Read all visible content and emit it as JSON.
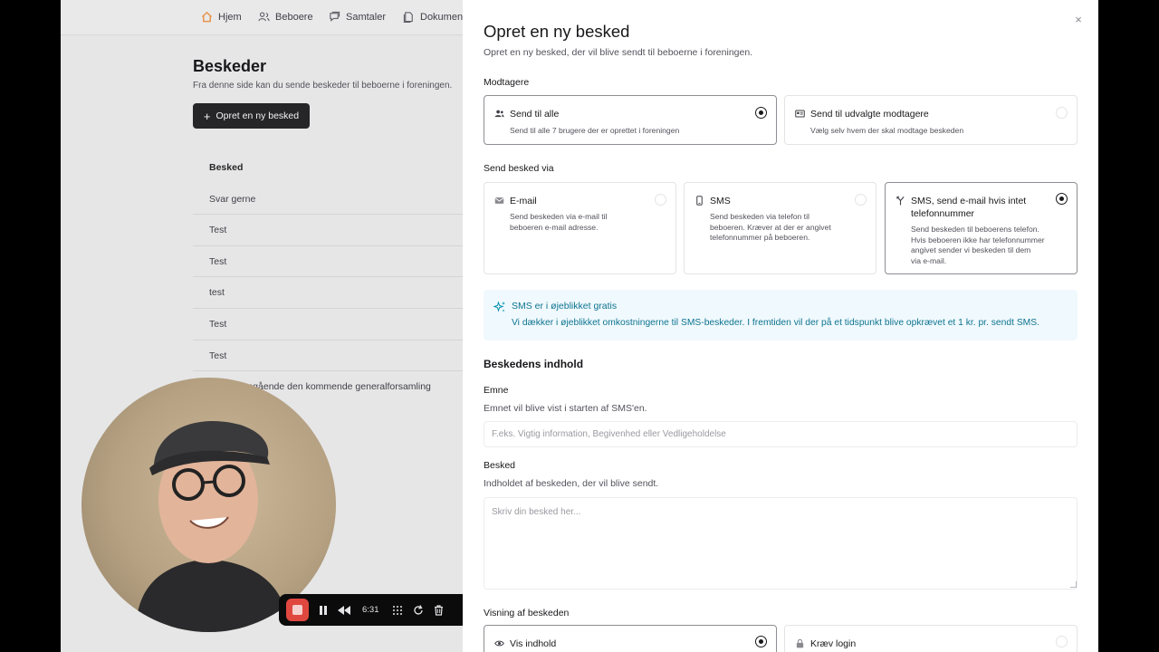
{
  "nav": {
    "items": [
      {
        "label": "Hjem",
        "icon": "home-icon"
      },
      {
        "label": "Beboere",
        "icon": "users-icon"
      },
      {
        "label": "Samtaler",
        "icon": "chat-icon"
      },
      {
        "label": "Dokumen",
        "icon": "document-icon"
      }
    ]
  },
  "page": {
    "title": "Beskeder",
    "subtitle": "Fra denne side kan du sende beskeder til beboerne i foreningen.",
    "new_button": "Opret en ny besked"
  },
  "table": {
    "header": "Besked",
    "rows": [
      "Svar gerne",
      "Test",
      "Test",
      "test",
      "Test",
      "Test",
      "…angående den kommende generalforsamling"
    ]
  },
  "recorder": {
    "time": "6:31"
  },
  "modal": {
    "title": "Opret en ny besked",
    "subtitle": "Opret en ny besked, der vil blive sendt til beboerne i foreningen.",
    "recipients": {
      "label": "Modtagere",
      "options": [
        {
          "title": "Send til alle",
          "desc": "Send til alle 7 brugere der er oprettet i foreningen",
          "selected": true
        },
        {
          "title": "Send til udvalgte modtagere",
          "desc": "Vælg selv hvem der skal modtage beskeden",
          "selected": false
        }
      ]
    },
    "channel": {
      "label": "Send besked via",
      "options": [
        {
          "title": "E-mail",
          "desc_lines": [
            "Send beskeden via e-mail til",
            "beboeren e-mail adresse."
          ],
          "selected": false
        },
        {
          "title": "SMS",
          "desc_lines": [
            "Send beskeden via telefon til",
            "beboeren. Kræver at der er angivet",
            "telefonnummer på beboeren."
          ],
          "selected": false
        },
        {
          "title_lines": [
            "SMS, send e-mail hvis intet",
            "telefonnummer"
          ],
          "desc_lines": [
            "Send beskeden til beboerens telefon.",
            "Hvis beboeren ikke har telefonnummer",
            "angivet sender vi beskeden til dem",
            "via e-mail."
          ],
          "selected": true
        }
      ]
    },
    "notice": {
      "title": "SMS er i øjeblikket gratis",
      "body": "Vi dækker i øjeblikket omkostningerne til SMS-beskeder. I fremtiden vil der på et tidspunkt blive opkrævet et 1 kr. pr. sendt SMS."
    },
    "content": {
      "section_title": "Beskedens indhold",
      "subject_label": "Emne",
      "subject_hint": "Emnet vil blive vist i starten af SMS'en.",
      "subject_placeholder": "F.eks. Vigtig information, Begivenhed eller Vedligeholdelse",
      "subject_value": "",
      "message_label": "Besked",
      "message_hint": "Indholdet af beskeden, der vil blive sendt.",
      "message_placeholder": "Skriv din besked her...",
      "message_value": ""
    },
    "visibility": {
      "label": "Visning af beskeden",
      "options": [
        {
          "title": "Vis indhold",
          "selected": true
        },
        {
          "title": "Kræv login",
          "selected": false
        }
      ]
    }
  },
  "colors": {
    "primary_button": "#262628",
    "info_bg": "#f0f9fd",
    "info_text": "#0e7490",
    "recorder_stop": "#e0483f"
  }
}
